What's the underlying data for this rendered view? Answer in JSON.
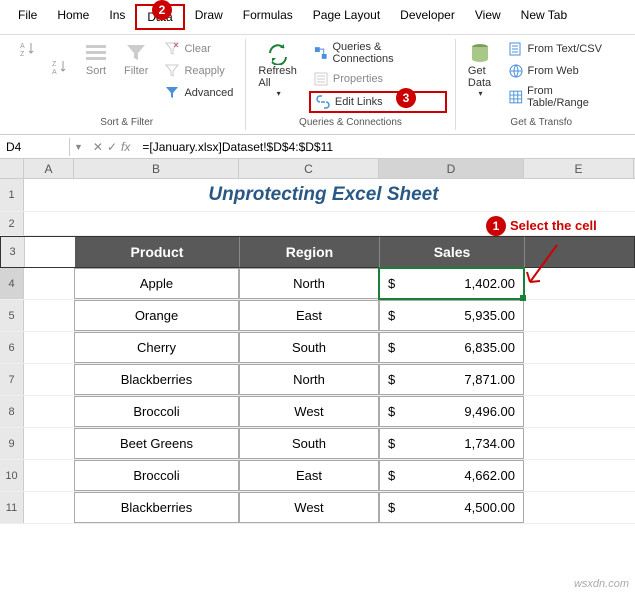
{
  "menu": [
    "File",
    "Home",
    "Ins",
    "Data",
    "Draw",
    "Formulas",
    "Page Layout",
    "Developer",
    "View",
    "New Tab"
  ],
  "active_menu_index": 3,
  "ribbon": {
    "sort_filter": {
      "sort": "Sort",
      "filter": "Filter",
      "clear": "Clear",
      "reapply": "Reapply",
      "advanced": "Advanced",
      "label": "Sort & Filter"
    },
    "queries": {
      "refresh": "Refresh\nAll",
      "qc": "Queries & Connections",
      "properties": "Properties",
      "edit_links": "Edit Links",
      "label": "Queries & Connections"
    },
    "getdata": {
      "get": "Get\nData",
      "textcsv": "From Text/CSV",
      "web": "From Web",
      "table": "From Table/Range",
      "label": "Get & Transfo"
    }
  },
  "namebox": "D4",
  "formula": "=[January.xlsx]Dataset!$D$4:$D$11",
  "cols": [
    "A",
    "B",
    "C",
    "D",
    "E"
  ],
  "title": "Unprotecting Excel Sheet",
  "headers": [
    "Product",
    "Region",
    "Sales"
  ],
  "rows": [
    {
      "product": "Apple",
      "region": "North",
      "sales": "1,402.00"
    },
    {
      "product": "Orange",
      "region": "East",
      "sales": "5,935.00"
    },
    {
      "product": "Cherry",
      "region": "South",
      "sales": "6,835.00"
    },
    {
      "product": "Blackberries",
      "region": "North",
      "sales": "7,871.00"
    },
    {
      "product": "Broccoli",
      "region": "West",
      "sales": "9,496.00"
    },
    {
      "product": "Beet Greens",
      "region": "South",
      "sales": "1,734.00"
    },
    {
      "product": "Broccoli",
      "region": "East",
      "sales": "4,662.00"
    },
    {
      "product": "Blackberries",
      "region": "West",
      "sales": "4,500.00"
    }
  ],
  "callouts": {
    "c1_num": "1",
    "c1_text": "Select the cell",
    "c2_num": "2",
    "c3_num": "3"
  },
  "watermark": "wsxdn.com",
  "currency": "$",
  "row_nums": [
    "1",
    "2",
    "3",
    "4",
    "5",
    "6",
    "7",
    "8",
    "9",
    "10",
    "11"
  ]
}
